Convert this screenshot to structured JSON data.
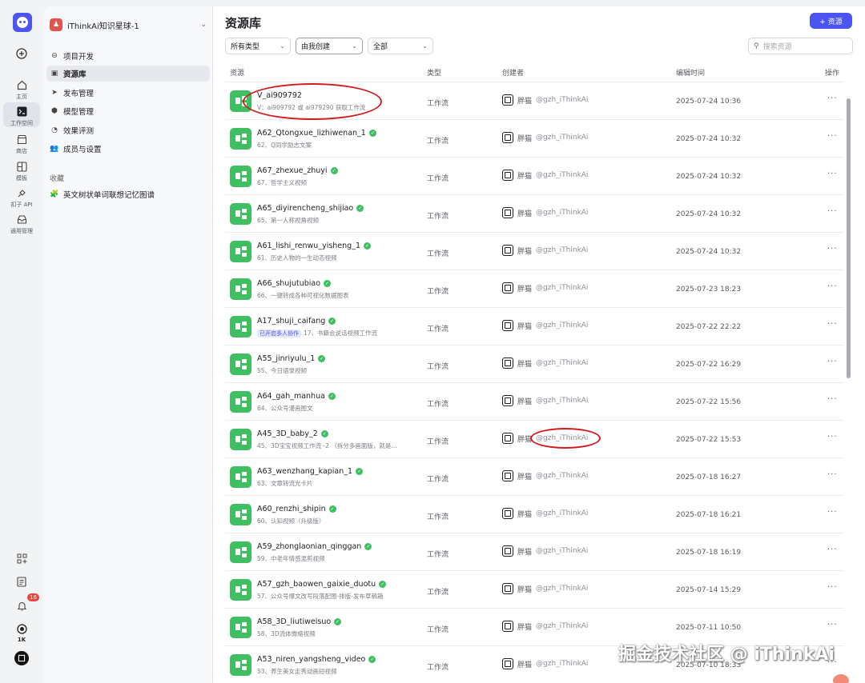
{
  "rail": {
    "items": [
      {
        "label": "主页"
      },
      {
        "label": "工作空间"
      },
      {
        "label": "商店"
      },
      {
        "label": "模板"
      },
      {
        "label": "扣子 API"
      },
      {
        "label": "通用管理"
      }
    ],
    "notification_count": "16",
    "bottom_label": "1K"
  },
  "sidebar": {
    "space_name": "iThinkAi知识星球-1",
    "nav": [
      {
        "label": "项目开发"
      },
      {
        "label": "资源库"
      },
      {
        "label": "发布管理"
      },
      {
        "label": "模型管理"
      },
      {
        "label": "效果评测"
      },
      {
        "label": "成员与设置"
      }
    ],
    "favorites_title": "收藏",
    "favorites": [
      {
        "label": "英文树状单词联想记忆图谱"
      }
    ]
  },
  "main": {
    "title": "资源库",
    "add_button": "+ 资源",
    "filters": [
      {
        "value": "所有类型"
      },
      {
        "value": "由我创建"
      },
      {
        "value": "全部"
      }
    ],
    "search_placeholder": "搜索资源",
    "columns": {
      "resource": "资源",
      "type": "类型",
      "creator": "创建者",
      "edited": "编辑时间",
      "actions": "操作"
    },
    "rows": [
      {
        "name": "V_ai909792",
        "desc": "V：ai909792 或 ai979290 获取工作流",
        "tag": "",
        "verified": false,
        "type": "工作流",
        "creator": "胖猫",
        "handle": "@gzh_iThinkAi",
        "time": "2025-07-24 10:36"
      },
      {
        "name": "A62_Qtongxue_lizhiwenan_1",
        "desc": "62、Q同学励志文案",
        "tag": "",
        "verified": true,
        "type": "工作流",
        "creator": "胖猫",
        "handle": "@gzh_iThinkAi",
        "time": "2025-07-24 10:32"
      },
      {
        "name": "A67_zhexue_zhuyi",
        "desc": "67、哲学主义视频",
        "tag": "",
        "verified": true,
        "type": "工作流",
        "creator": "胖猫",
        "handle": "@gzh_iThinkAi",
        "time": "2025-07-24 10:32"
      },
      {
        "name": "A65_diyirencheng_shijiao",
        "desc": "65、第一人称视角视频",
        "tag": "",
        "verified": true,
        "type": "工作流",
        "creator": "胖猫",
        "handle": "@gzh_iThinkAi",
        "time": "2025-07-24 10:32"
      },
      {
        "name": "A61_lishi_renwu_yisheng_1",
        "desc": "61、历史人物的一生动态视频",
        "tag": "",
        "verified": true,
        "type": "工作流",
        "creator": "胖猫",
        "handle": "@gzh_iThinkAi",
        "time": "2025-07-24 10:32"
      },
      {
        "name": "A66_shujutubiao",
        "desc": "66、一键转成各种可视化数据图表",
        "tag": "",
        "verified": true,
        "type": "工作流",
        "creator": "胖猫",
        "handle": "@gzh_iThinkAi",
        "time": "2025-07-23 18:23"
      },
      {
        "name": "A17_shuji_caifang",
        "desc": "17、书籍会说话视频工作流",
        "tag": "已开启多人协作",
        "verified": true,
        "type": "工作流",
        "creator": "胖猫",
        "handle": "@gzh_iThinkAi",
        "time": "2025-07-22 22:22"
      },
      {
        "name": "A55_jinriyulu_1",
        "desc": "55、今日语录视频",
        "tag": "",
        "verified": true,
        "type": "工作流",
        "creator": "胖猫",
        "handle": "@gzh_iThinkAi",
        "time": "2025-07-22 16:29"
      },
      {
        "name": "A64_gah_manhua",
        "desc": "64、公众号漫画图文",
        "tag": "",
        "verified": true,
        "type": "工作流",
        "creator": "胖猫",
        "handle": "@gzh_iThinkAi",
        "time": "2025-07-22 15:56"
      },
      {
        "name": "A45_3D_baby_2",
        "desc": "45、3D宝宝视频工作流 -2 （拆分多画面版，就是...",
        "tag": "",
        "verified": true,
        "type": "工作流",
        "creator": "胖猫",
        "handle": "@gzh_iThinkAi",
        "time": "2025-07-22 15:53"
      },
      {
        "name": "A63_wenzhang_kapian_1",
        "desc": "63、文章转流光卡片",
        "tag": "",
        "verified": true,
        "type": "工作流",
        "creator": "胖猫",
        "handle": "@gzh_iThinkAi",
        "time": "2025-07-18 16:27"
      },
      {
        "name": "A60_renzhi_shipin",
        "desc": "60、认知视频（升级版）",
        "tag": "",
        "verified": true,
        "type": "工作流",
        "creator": "胖猫",
        "handle": "@gzh_iThinkAi",
        "time": "2025-07-18 16:21"
      },
      {
        "name": "A59_zhonglaonian_qinggan",
        "desc": "59、中老年情感混剪视频",
        "tag": "",
        "verified": true,
        "type": "工作流",
        "creator": "胖猫",
        "handle": "@gzh_iThinkAi",
        "time": "2025-07-18 16:19"
      },
      {
        "name": "A57_gzh_baowen_gaixie_duotu",
        "desc": "57、公众号爆文改写段落配图-排版-发布草稿箱",
        "tag": "",
        "verified": true,
        "type": "工作流",
        "creator": "胖猫",
        "handle": "@gzh_iThinkAi",
        "time": "2025-07-14 15:29"
      },
      {
        "name": "A58_3D_liutiweisuo",
        "desc": "58、3D流体微缩视频",
        "tag": "",
        "verified": true,
        "type": "工作流",
        "creator": "胖猫",
        "handle": "@gzh_iThinkAi",
        "time": "2025-07-11 10:50"
      },
      {
        "name": "A53_niren_yangsheng_video",
        "desc": "53、养生美女走秀动画短视频",
        "tag": "",
        "verified": true,
        "type": "工作流",
        "creator": "胖猫",
        "handle": "@gzh_iThinkAi",
        "time": "2025-07-10 18:33"
      }
    ]
  },
  "watermark": "掘金技术社区 @ iThinkAi",
  "colors": {
    "accent": "#4c54f0",
    "workflow_icon": "#3fbf62",
    "annotation": "#d11c1c"
  }
}
